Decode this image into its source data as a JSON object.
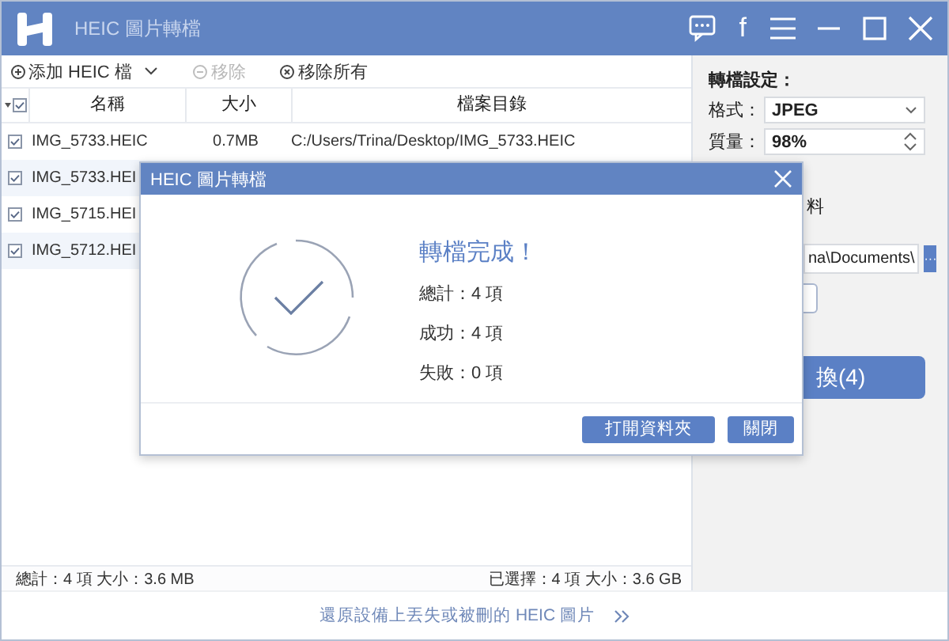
{
  "window": {
    "title": "HEIC 圖片轉檔",
    "controls": [
      {
        "kind": "chat"
      },
      {
        "kind": "facebook",
        "label": "f"
      },
      {
        "kind": "menu"
      },
      {
        "kind": "minimize"
      },
      {
        "kind": "maximize"
      },
      {
        "kind": "close"
      }
    ]
  },
  "toolbar": [
    {
      "kind": "add",
      "label": "添加 HEIC 檔",
      "disabled": false,
      "dropdown": true
    },
    {
      "kind": "remove",
      "label": "移除",
      "disabled": true,
      "dropdown": false
    },
    {
      "kind": "clear",
      "label": "移除所有",
      "disabled": false,
      "dropdown": false
    }
  ],
  "table": {
    "all_checked": true,
    "columns": [
      "名稱",
      "大小",
      "檔案目錄"
    ],
    "rows": [
      {
        "checked": true,
        "name": "IMG_5733.HEIC",
        "size": "0.7MB",
        "path": "C:/Users/Trina/Desktop/IMG_5733.HEIC"
      },
      {
        "checked": true,
        "name": "IMG_5733.HEI"
      },
      {
        "checked": true,
        "name": "IMG_5715.HEI"
      },
      {
        "checked": true,
        "name": "IMG_5712.HEI"
      }
    ]
  },
  "status_bar": {
    "total": "總計：4 項 大小：3.6 MB",
    "selected": "已選擇：4 項 大小：3.6 GB"
  },
  "settings": {
    "title": "轉檔設定：",
    "format_label": "格式：",
    "format": "JPEG",
    "quality_label": "質量：",
    "quality": "98%",
    "option_fragment": "料",
    "output_path": "na\\Documents\\",
    "browse_button": "···",
    "convert_button": "換(4)"
  },
  "footer_link": "還原設備上丟失或被刪的 HEIC 圖片",
  "dialog": {
    "title": "HEIC 圖片轉檔",
    "heading": "轉檔完成！",
    "lines": [
      "總計：4 項",
      "成功：4 項",
      "失敗：0 項"
    ],
    "buttons": [
      "打開資料夾",
      "關閉"
    ]
  }
}
